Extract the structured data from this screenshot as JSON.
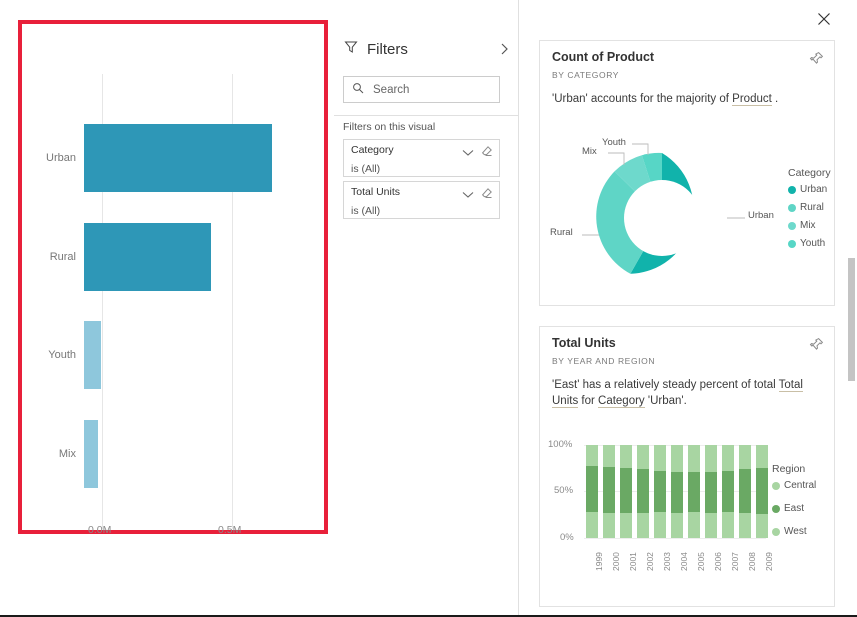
{
  "left_visual": {
    "name": "count-of-product-by-category-bar-chart",
    "highlight_color": "#e8203a",
    "axis_labels": [
      "0.0M",
      "0.5M"
    ],
    "categories": [
      "Urban",
      "Rural",
      "Youth",
      "Mix"
    ]
  },
  "filters_pane": {
    "title": "Filters",
    "expand_icon": "chevron-right-icon",
    "filter_icon": "funnel-icon",
    "search_icon": "search-icon",
    "search_placeholder": "Search",
    "section_label": "Filters on this visual",
    "cards": [
      {
        "field": "Category",
        "condition": "is (All)",
        "chevron": "chevron-down-icon",
        "eraser": "eraser-icon"
      },
      {
        "field": "Total Units",
        "condition": "is (All)",
        "chevron": "chevron-down-icon",
        "eraser": "eraser-icon"
      }
    ]
  },
  "right_pane": {
    "close_icon": "close-icon",
    "scrollbar": "vertical-scrollbar",
    "cards": [
      {
        "title": "Count of Product",
        "subtitle": "BY CATEGORY",
        "pin_icon": "pin-icon",
        "description_parts": [
          {
            "text": "'Urban' accounts for the majority of ",
            "underline": false
          },
          {
            "text": "Product",
            "underline": true
          },
          {
            "text": " .",
            "underline": false
          }
        ]
      },
      {
        "title": "Total Units",
        "subtitle": "BY YEAR AND REGION",
        "pin_icon": "pin-icon",
        "description_parts": [
          {
            "text": "'East' has a relatively steady percent of total ",
            "underline": false
          },
          {
            "text": "Total Units",
            "underline": true
          },
          {
            "text": " for ",
            "underline": false
          },
          {
            "text": "Category",
            "underline": true
          },
          {
            "text": " 'Urban'.",
            "underline": false
          }
        ]
      }
    ]
  },
  "chart_data": [
    {
      "type": "bar",
      "name": "count-of-product-by-category",
      "orientation": "horizontal",
      "title": "",
      "xlabel": "",
      "ylabel": "",
      "categories": [
        "Urban",
        "Rural",
        "Youth",
        "Mix"
      ],
      "values": [
        0.62,
        0.42,
        0.055,
        0.045
      ],
      "value_unit": "M",
      "xlim": [
        0,
        0.75
      ],
      "tick_labels": [
        "0.0M",
        "0.5M"
      ],
      "tick_values": [
        0,
        0.5
      ],
      "grid": true,
      "bar_colors": [
        "#2e97b7",
        "#2e97b7",
        "#8ec7dc",
        "#8ec7dc"
      ],
      "legend": "none"
    },
    {
      "type": "pie",
      "name": "count-of-product-donut",
      "title": "Count of Product",
      "subtitle": "BY CATEGORY",
      "labels": [
        "Urban",
        "Rural",
        "Mix",
        "Youth"
      ],
      "values": [
        58,
        30,
        7,
        5
      ],
      "colors": [
        "#11b3ab",
        "#5fd5c6",
        "#6ed9cc",
        "#57d6c6"
      ],
      "donut": true,
      "legend_title": "Category",
      "legend_position": "right",
      "callout_labels": [
        "Urban",
        "Rural",
        "Mix",
        "Youth"
      ]
    },
    {
      "type": "bar",
      "name": "total-units-by-year-and-region",
      "stacked": true,
      "normalized": true,
      "title": "Total Units",
      "subtitle": "BY YEAR AND REGION",
      "xlabel": "",
      "ylabel": "",
      "categories": [
        "1999",
        "2000",
        "2001",
        "2002",
        "2003",
        "2004",
        "2005",
        "2006",
        "2007",
        "2008",
        "2009"
      ],
      "ylim": [
        0,
        100
      ],
      "tick_labels": [
        "0%",
        "50%",
        "100%"
      ],
      "tick_values": [
        0,
        50,
        100
      ],
      "grid": true,
      "legend_title": "Region",
      "legend_position": "right",
      "series": [
        {
          "name": "West",
          "color": "#a8d5a2",
          "values": [
            22,
            24,
            25,
            26,
            28,
            29,
            29,
            29,
            28,
            26,
            25
          ]
        },
        {
          "name": "East",
          "color": "#6aa964",
          "values": [
            49,
            49,
            48,
            47,
            44,
            44,
            43,
            44,
            44,
            48,
            50
          ]
        },
        {
          "name": "Central",
          "color": "#a8d5a2",
          "values": [
            29,
            27,
            27,
            27,
            28,
            27,
            28,
            27,
            28,
            26,
            25
          ]
        }
      ],
      "legend_entries": [
        {
          "name": "Central",
          "color": "#a8d5a2"
        },
        {
          "name": "East",
          "color": "#6aa964"
        },
        {
          "name": "West",
          "color": "#a8d5a2"
        }
      ]
    }
  ]
}
